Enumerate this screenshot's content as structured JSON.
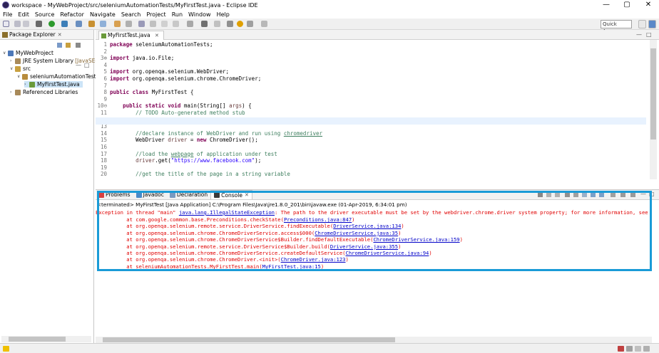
{
  "window": {
    "title": "workspace - MyWebProject/src/seleniumAutomationTests/MyFirstTest.java - Eclipse IDE",
    "controls": [
      "—",
      "▢",
      "✕"
    ]
  },
  "menu": [
    "File",
    "Edit",
    "Source",
    "Refactor",
    "Navigate",
    "Search",
    "Project",
    "Run",
    "Window",
    "Help"
  ],
  "toolbar": {
    "quick_access": "Quick Access"
  },
  "package_explorer": {
    "tab_label": "Package Explorer",
    "tree": [
      {
        "label": "MyWebProject",
        "icon": "project-icon",
        "arrow": "∨"
      },
      {
        "label": "JRE System Library",
        "extra": "[JavaSE-1.8]",
        "icon": "library-icon",
        "arrow": "›"
      },
      {
        "label": "src",
        "icon": "source-folder-icon",
        "arrow": "∨"
      },
      {
        "label": "seleniumAutomationTests",
        "icon": "package-icon",
        "arrow": "∨"
      },
      {
        "label": "MyFirstTest.java",
        "icon": "java-file-icon",
        "arrow": "›"
      },
      {
        "label": "Referenced Libraries",
        "icon": "library-icon",
        "arrow": "›"
      }
    ]
  },
  "editor": {
    "tab_label": "MyFirstTest.java",
    "lines": [
      {
        "n": "1",
        "parts": [
          {
            "t": "package",
            "c": "kw"
          },
          {
            "t": " seleniumAutomationTests;",
            "c": ""
          }
        ]
      },
      {
        "n": "2",
        "parts": []
      },
      {
        "n": "3⊕",
        "parts": [
          {
            "t": "import",
            "c": "kw"
          },
          {
            "t": " java.io.File;",
            "c": ""
          }
        ]
      },
      {
        "n": "4",
        "parts": []
      },
      {
        "n": "5",
        "parts": [
          {
            "t": "import",
            "c": "kw"
          },
          {
            "t": " org.openqa.selenium.WebDriver;",
            "c": ""
          }
        ]
      },
      {
        "n": "6",
        "parts": [
          {
            "t": "import",
            "c": "kw"
          },
          {
            "t": " org.openqa.selenium.chrome.ChromeDriver;",
            "c": ""
          }
        ]
      },
      {
        "n": "7",
        "parts": []
      },
      {
        "n": "8",
        "parts": [
          {
            "t": "public class",
            "c": "kw"
          },
          {
            "t": " MyFirstTest {",
            "c": ""
          }
        ]
      },
      {
        "n": "9",
        "parts": []
      },
      {
        "n": "10⊖",
        "parts": [
          {
            "t": "    ",
            "c": ""
          },
          {
            "t": "public static void",
            "c": "kw"
          },
          {
            "t": " main(String[] ",
            "c": ""
          },
          {
            "t": "args",
            "c": "var"
          },
          {
            "t": ") {",
            "c": ""
          }
        ]
      },
      {
        "n": "11",
        "parts": [
          {
            "t": "        ",
            "c": ""
          },
          {
            "t": "// TODO Auto-generated method stub",
            "c": "cm"
          }
        ]
      },
      {
        "n": "12",
        "parts": []
      },
      {
        "n": "13",
        "parts": []
      },
      {
        "n": "14",
        "parts": [
          {
            "t": "        ",
            "c": ""
          },
          {
            "t": "//declare instance of WebDriver and run using ",
            "c": "cm"
          },
          {
            "t": "chromedriver",
            "c": "cm ul"
          }
        ]
      },
      {
        "n": "15",
        "parts": [
          {
            "t": "        WebDriver ",
            "c": ""
          },
          {
            "t": "driver",
            "c": "var"
          },
          {
            "t": " = ",
            "c": ""
          },
          {
            "t": "new",
            "c": "kw"
          },
          {
            "t": " ChromeDriver();",
            "c": ""
          }
        ]
      },
      {
        "n": "16",
        "parts": []
      },
      {
        "n": "17",
        "parts": [
          {
            "t": "        ",
            "c": ""
          },
          {
            "t": "//load the ",
            "c": "cm"
          },
          {
            "t": "webpage",
            "c": "cm ul"
          },
          {
            "t": " of application under test",
            "c": "cm"
          }
        ]
      },
      {
        "n": "18",
        "parts": [
          {
            "t": "        ",
            "c": ""
          },
          {
            "t": "driver",
            "c": "var"
          },
          {
            "t": ".get(",
            "c": ""
          },
          {
            "t": "\"https://www.facebook.com\"",
            "c": "str"
          },
          {
            "t": ");",
            "c": ""
          }
        ]
      },
      {
        "n": "19",
        "parts": []
      },
      {
        "n": "20",
        "parts": [
          {
            "t": "        ",
            "c": ""
          },
          {
            "t": "//get the title of the page in a string variable",
            "c": "cm"
          }
        ]
      }
    ]
  },
  "bottom_panel": {
    "tabs": [
      {
        "label": "Problems",
        "icon": "problems-icon",
        "active": false
      },
      {
        "label": "Javadoc",
        "icon": "javadoc-icon",
        "active": false
      },
      {
        "label": "Declaration",
        "icon": "declaration-icon",
        "active": false
      },
      {
        "label": "Console",
        "icon": "console-icon",
        "active": true
      }
    ],
    "terminated": "<terminated> MyFirstTest [Java Application] C:\\Program Files\\Java\\jre1.8.0_201\\bin\\javaw.exe (01-Apr-2019, 6:34:01 pm)",
    "exception": {
      "prefix": "Exception in thread \"main\" ",
      "link": "java.lang.IllegalStateException",
      "message": ": The path to the driver executable must be set by the webdriver.chrome.driver system property; for more information, see"
    },
    "stack": [
      {
        "text": "\tat com.google.common.base.Preconditions.checkState(",
        "link": "Preconditions.java:847",
        "end": ")"
      },
      {
        "text": "\tat org.openqa.selenium.remote.service.DriverService.findExecutable(",
        "link": "DriverService.java:134",
        "end": ")"
      },
      {
        "text": "\tat org.openqa.selenium.chrome.ChromeDriverService.access$000(",
        "link": "ChromeDriverService.java:35",
        "end": ")"
      },
      {
        "text": "\tat org.openqa.selenium.chrome.ChromeDriverService$Builder.findDefaultExecutable(",
        "link": "ChromeDriverService.java:159",
        "end": ")"
      },
      {
        "text": "\tat org.openqa.selenium.remote.service.DriverService$Builder.build(",
        "link": "DriverService.java:355",
        "end": ")"
      },
      {
        "text": "\tat org.openqa.selenium.chrome.ChromeDriverService.createDefaultService(",
        "link": "ChromeDriverService.java:94",
        "end": ")"
      },
      {
        "text": "\tat org.openqa.selenium.chrome.ChromeDriver.<init>(",
        "link": "ChromeDriver.java:123",
        "end": ")"
      },
      {
        "text": "\tat seleniumAutomationTests.MyFirstTest.main(",
        "link": "MyFirstTest.java:15",
        "end": ")"
      }
    ]
  },
  "colors": {
    "highlight_border": "#1a9bd7",
    "keyword": "#7f0055",
    "comment": "#3f7f5f",
    "string": "#2a00ff",
    "error": "#e00000",
    "link": "#0000c8"
  }
}
